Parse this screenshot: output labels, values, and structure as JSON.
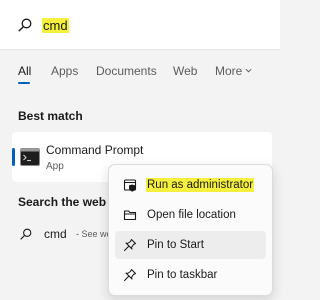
{
  "search": {
    "query": "cmd"
  },
  "tabs": [
    {
      "label": "All",
      "active": true
    },
    {
      "label": "Apps"
    },
    {
      "label": "Documents"
    },
    {
      "label": "Web"
    },
    {
      "label": "More"
    }
  ],
  "best_match": {
    "heading": "Best match",
    "title": "Command Prompt",
    "subtitle": "App",
    "icon": "terminal-icon"
  },
  "web_section": {
    "heading": "Search the web",
    "query": "cmd",
    "see_text": "- See web"
  },
  "context_menu": {
    "items": [
      {
        "label": "Run as administrator",
        "icon": "shield-icon",
        "highlighted": true
      },
      {
        "label": "Open file location",
        "icon": "folder-icon"
      },
      {
        "label": "Pin to Start",
        "icon": "pin-icon",
        "hovered": true
      },
      {
        "label": "Pin to taskbar",
        "icon": "pin-icon"
      }
    ]
  },
  "colors": {
    "accent": "#005fb8",
    "highlight": "#f5ef3e",
    "background": "#f3f3f3"
  }
}
